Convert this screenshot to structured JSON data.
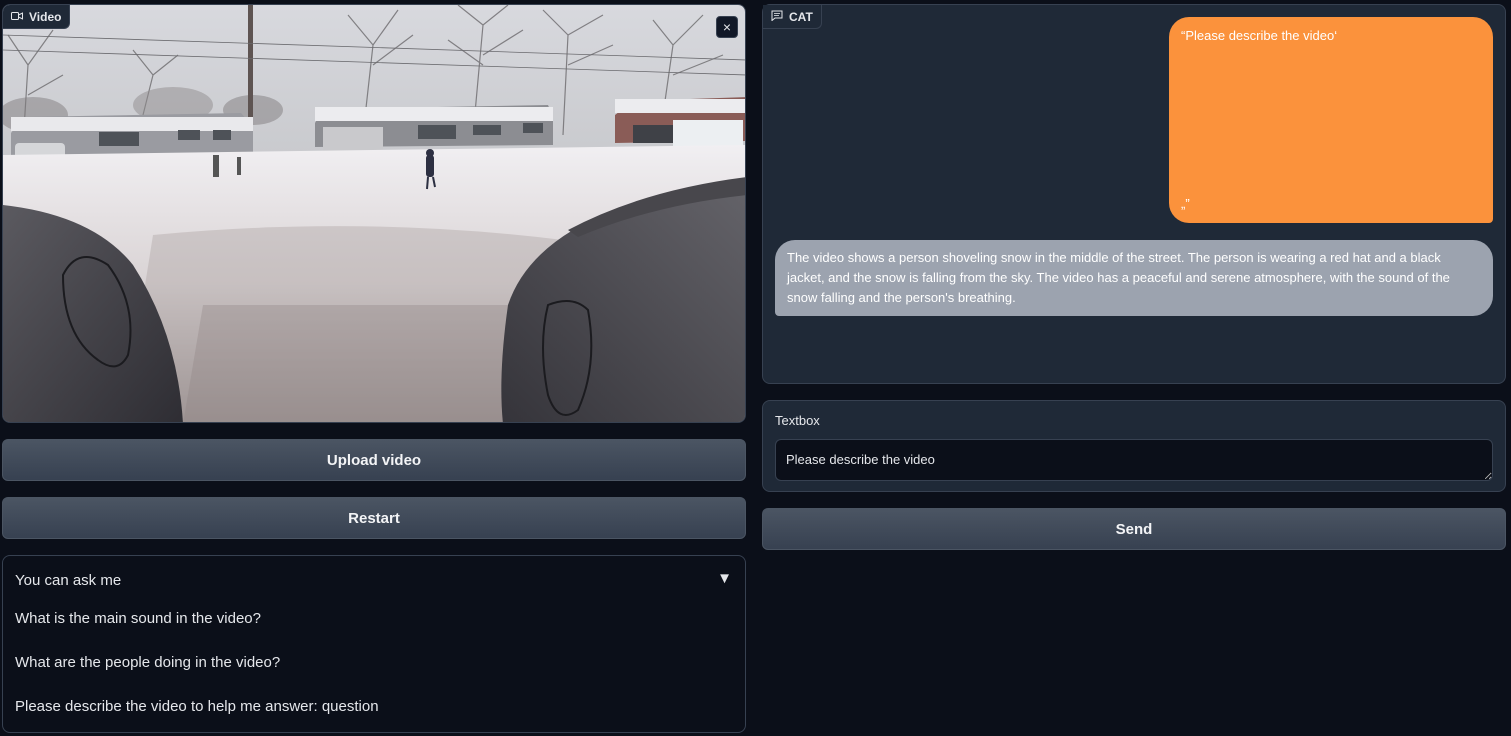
{
  "video": {
    "label": "Video",
    "close_symbol": "×"
  },
  "buttons": {
    "upload": "Upload video",
    "restart": "Restart",
    "send": "Send"
  },
  "examples": {
    "title": "You can ask me",
    "toggle_symbol": "▼",
    "items": [
      "What is the main sound in the video?",
      "What are the people doing in the video?",
      "Please describe the video to help me answer: question"
    ]
  },
  "chat": {
    "label": "CAT",
    "user_open": "“Please describe the video‘",
    "user_close": "„”",
    "bot_message": "The video shows a person shoveling snow in the middle of the street. The person is wearing a red hat and a black jacket, and the snow is falling from the sky. The video has a peaceful and serene atmosphere, with the sound of the snow falling and the person's breathing."
  },
  "textbox": {
    "label": "Textbox",
    "value": "Please describe the video"
  },
  "colors": {
    "background": "#0b0f19",
    "panel": "#1f2937",
    "user_bubble": "#fb923c",
    "bot_bubble": "#9ca3af",
    "button": "#4b5563"
  }
}
